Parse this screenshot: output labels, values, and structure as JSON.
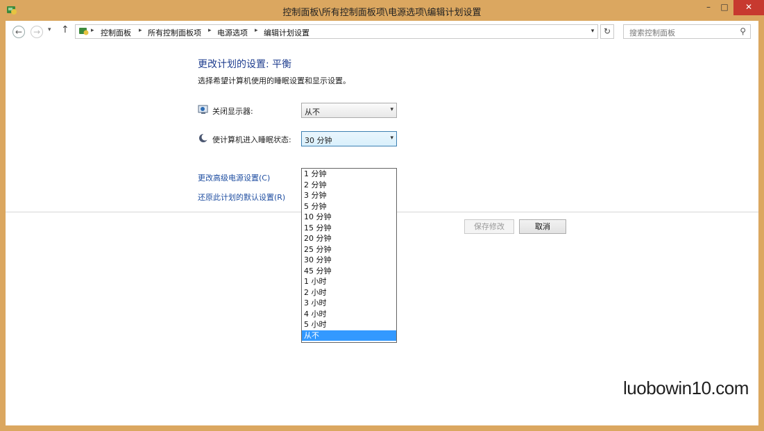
{
  "window": {
    "title": "控制面板\\所有控制面板项\\电源选项\\编辑计划设置",
    "controls": {
      "minimize": "–",
      "maximize": "□",
      "close": "✕"
    }
  },
  "nav": {
    "back_icon": "←",
    "forward_icon": "→",
    "recent_icon": "▾",
    "up_icon": "↑",
    "breadcrumbs": [
      "控制面板",
      "所有控制面板项",
      "电源选项",
      "编辑计划设置"
    ],
    "separator": "▸",
    "dropdown_icon": "▾",
    "refresh_icon": "↻",
    "search_placeholder": "搜索控制面板",
    "search_icon": "⚲"
  },
  "page": {
    "heading": "更改计划的设置: 平衡",
    "subheading": "选择希望计算机使用的睡眠设置和显示设置。",
    "display_off": {
      "label": "关闭显示器:",
      "value": "从不"
    },
    "sleep": {
      "label": "使计算机进入睡眠状态:",
      "value": "30 分钟"
    },
    "dropdown_options": [
      "1 分钟",
      "2 分钟",
      "3 分钟",
      "5 分钟",
      "10 分钟",
      "15 分钟",
      "20 分钟",
      "25 分钟",
      "30 分钟",
      "45 分钟",
      "1 小时",
      "2 小时",
      "3 小时",
      "4 小时",
      "5 小时",
      "从不"
    ],
    "highlighted_option": "从不",
    "link_advanced": "更改高级电源设置(C)",
    "link_restore": "还原此计划的默认设置(R)",
    "save_button": "保存修改",
    "cancel_button": "取消"
  },
  "watermark": "luobowin10.com",
  "colors": {
    "frame": "#dba760",
    "heading": "#1e3d8f",
    "link": "#1f4ea1",
    "selection": "#3399ff"
  }
}
